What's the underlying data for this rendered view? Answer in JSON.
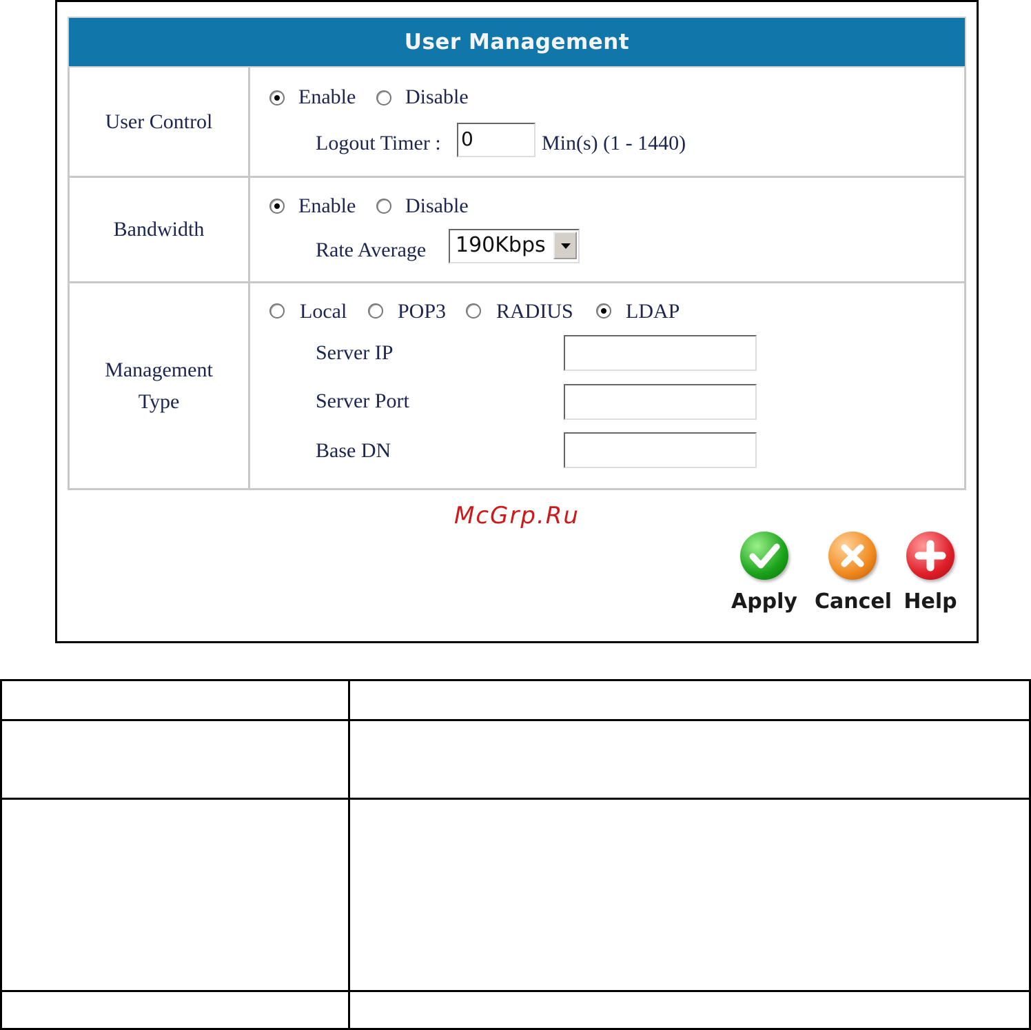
{
  "panel": {
    "title": "User Management",
    "rows": {
      "user_control": {
        "label": "User Control",
        "options": {
          "enable": "Enable",
          "disable": "Disable",
          "selected": "Enable"
        },
        "logout_timer_label": "Logout Timer :",
        "logout_timer_value": "0",
        "logout_timer_unit": "Min(s) (1 - 1440)"
      },
      "bandwidth": {
        "label": "Bandwidth",
        "options": {
          "enable": "Enable",
          "disable": "Disable",
          "selected": "Enable"
        },
        "rate_label": "Rate Average",
        "rate_value": "190Kbps"
      },
      "management_type": {
        "label_line1": "Management",
        "label_line2": "Type",
        "options": {
          "local": "Local",
          "pop3": "POP3",
          "radius": "RADIUS",
          "ldap": "LDAP",
          "selected": "LDAP"
        },
        "server_ip_label": "Server IP",
        "server_ip_value": "",
        "server_port_label": "Server Port",
        "server_port_value": "",
        "base_dn_label": "Base DN",
        "base_dn_value": ""
      }
    },
    "buttons": {
      "apply": "Apply",
      "cancel": "Cancel",
      "help": "Help"
    }
  },
  "watermark": "McGrp.Ru",
  "colors": {
    "header": "#1177aa",
    "apply": "#1aa21a",
    "cancel": "#f08a1e",
    "help": "#e01f2a"
  }
}
